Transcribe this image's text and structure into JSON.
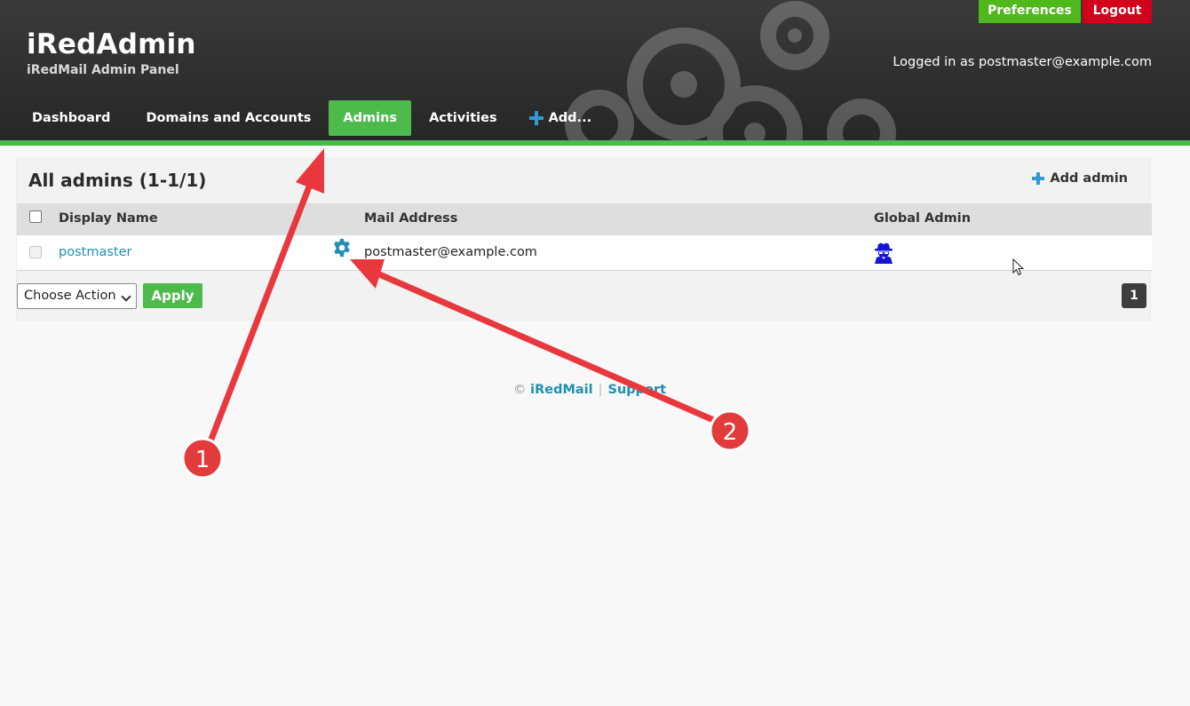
{
  "header": {
    "title": "iRedAdmin",
    "subtitle": "iRedMail Admin Panel",
    "logged_in": "Logged in as postmaster@example.com",
    "preferences": "Preferences",
    "logout": "Logout"
  },
  "nav": {
    "items": [
      {
        "label": "Dashboard"
      },
      {
        "label": "Domains and Accounts"
      },
      {
        "label": "Admins"
      },
      {
        "label": "Activities"
      },
      {
        "label": "Add..."
      }
    ]
  },
  "panel": {
    "title": "All admins (1-1/1)",
    "add_admin": "Add admin",
    "columns": [
      "Display Name",
      "Mail Address",
      "Global Admin"
    ],
    "rows": [
      {
        "display_name": "postmaster",
        "mail": "postmaster@example.com"
      }
    ],
    "action_select": "Choose Action",
    "apply": "Apply",
    "page": "1"
  },
  "footer": {
    "copyright": "©",
    "iredmail": "iRedMail",
    "support": "Support"
  },
  "annotations": [
    "1",
    "2"
  ],
  "colors": {
    "accent_green": "#4cbb4c",
    "logout_red": "#d2001a",
    "link": "#1f8fb3",
    "annotation_red": "#e8383e"
  }
}
